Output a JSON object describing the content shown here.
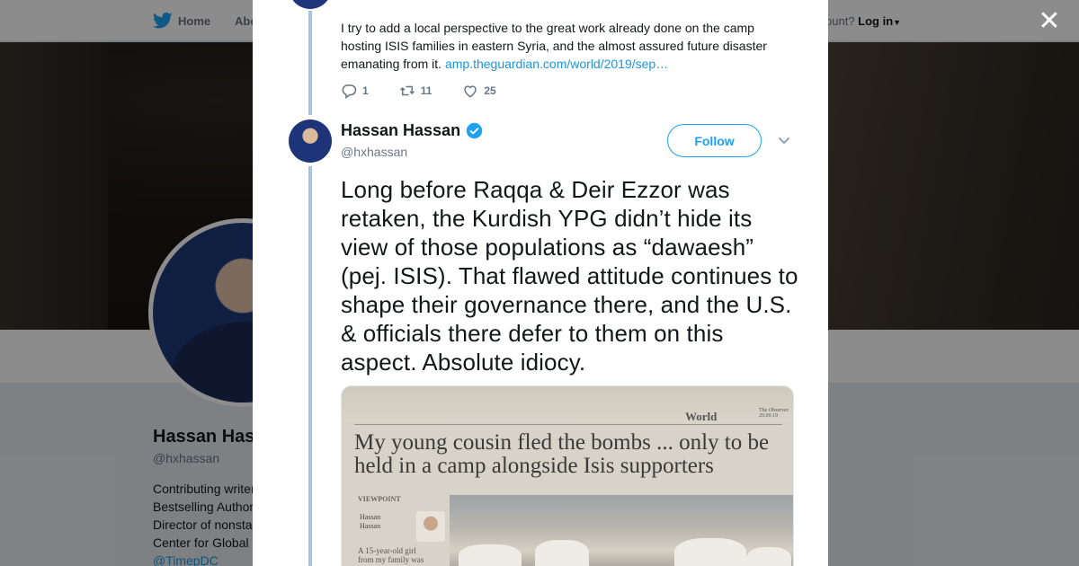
{
  "background": {
    "nav": {
      "home_label": "Home",
      "about_label": "Abo",
      "account_prompt": "ccount?",
      "login_label": "Log in"
    },
    "profile": {
      "name": "Hassan Has",
      "handle": "@hxhassan",
      "bio_lines": [
        "Contributing writer",
        "Bestselling Author",
        "Director of nonsta",
        "Center for Global"
      ],
      "bio_link": "@TimepDC"
    }
  },
  "modal": {
    "close_icon": "close-icon",
    "previous_tweet": {
      "text": "I try to add a local perspective to the great work already done on the camp hosting ISIS families in eastern Syria, and the almost assured future disaster emanating from it.",
      "link": "amp.theguardian.com/world/2019/sep…",
      "replies": "1",
      "retweets": "11",
      "likes": "25"
    },
    "tweet": {
      "name": "Hassan Hassan",
      "handle": "@hxhassan",
      "follow_label": "Follow",
      "text": "Long before Raqqa & Deir Ezzor was retaken, the Kurdish YPG didn’t hide its view of those populations as “dawaesh” (pej. ISIS). That flawed attitude continues to shape their governance there, and the U.S. & officials there defer to them on this aspect. Absolute idiocy.",
      "media": {
        "section": "World",
        "paper": "The Observer",
        "paper_date": "29.09.19",
        "headline": "My young cousin fled the bombs ... only to be held in a camp alongside Isis supporters",
        "viewpoint_label": "VIEWPOINT",
        "author_first": "Hassan",
        "author_last": "Hassan",
        "caption_line1": "A 15-year-old girl",
        "caption_line2": "from my family was"
      }
    }
  },
  "colors": {
    "twitter_blue": "#1da1f2",
    "link_blue": "#1b95e0",
    "thread_line": "#a8c4e0",
    "text": "#14171a",
    "muted": "#657786"
  }
}
